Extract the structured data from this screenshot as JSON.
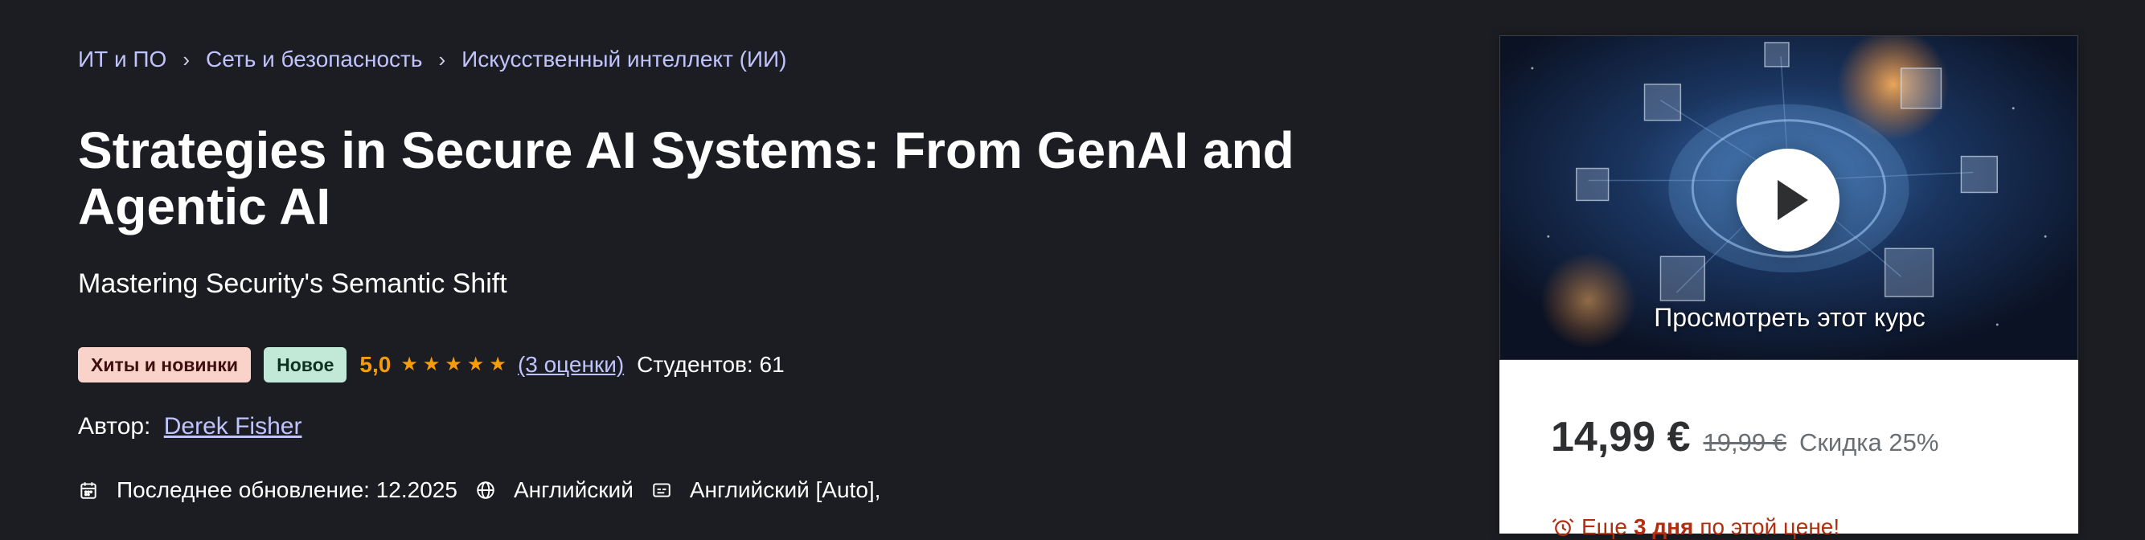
{
  "breadcrumb": {
    "items": [
      "ИТ и ПО",
      "Сеть и безопасность",
      "Искусственный интеллект (ИИ)"
    ],
    "separator": "›"
  },
  "course": {
    "title": "Strategies in Secure AI Systems: From GenAI and Agentic AI",
    "subtitle": "Mastering Security's Semantic Shift",
    "badges": {
      "bestseller": "Хиты и новинки",
      "new": "Новое"
    },
    "rating": "5,0",
    "stars": 5,
    "rating_count": "(3 оценки)",
    "students": "Студентов: 61",
    "author_label": "Автор:",
    "author_name": "Derek Fisher",
    "last_updated": "Последнее обновление: 12.2025",
    "language": "Английский",
    "captions": "Английский [Auto],"
  },
  "sidebar": {
    "preview_label": "Просмотреть этот курс",
    "price": "14,99 €",
    "old_price": "19,99 €",
    "discount": "Скидка 25%",
    "timer_prefix": "Еще",
    "timer_days": "3 дня",
    "timer_suffix": "по этой цене!"
  },
  "colors": {
    "background": "#1c1d22",
    "link": "#c0c4fc",
    "rating": "#f69c08",
    "urgent": "#b32d0f",
    "price": "#2d2f31"
  },
  "icons": {
    "breadcrumb_separator": "chevron-right-icon",
    "star": "star-icon",
    "last_updated": "calendar-icon",
    "language": "globe-icon",
    "captions": "closed-captions-icon",
    "play": "play-icon",
    "timer": "alarm-clock-icon"
  }
}
